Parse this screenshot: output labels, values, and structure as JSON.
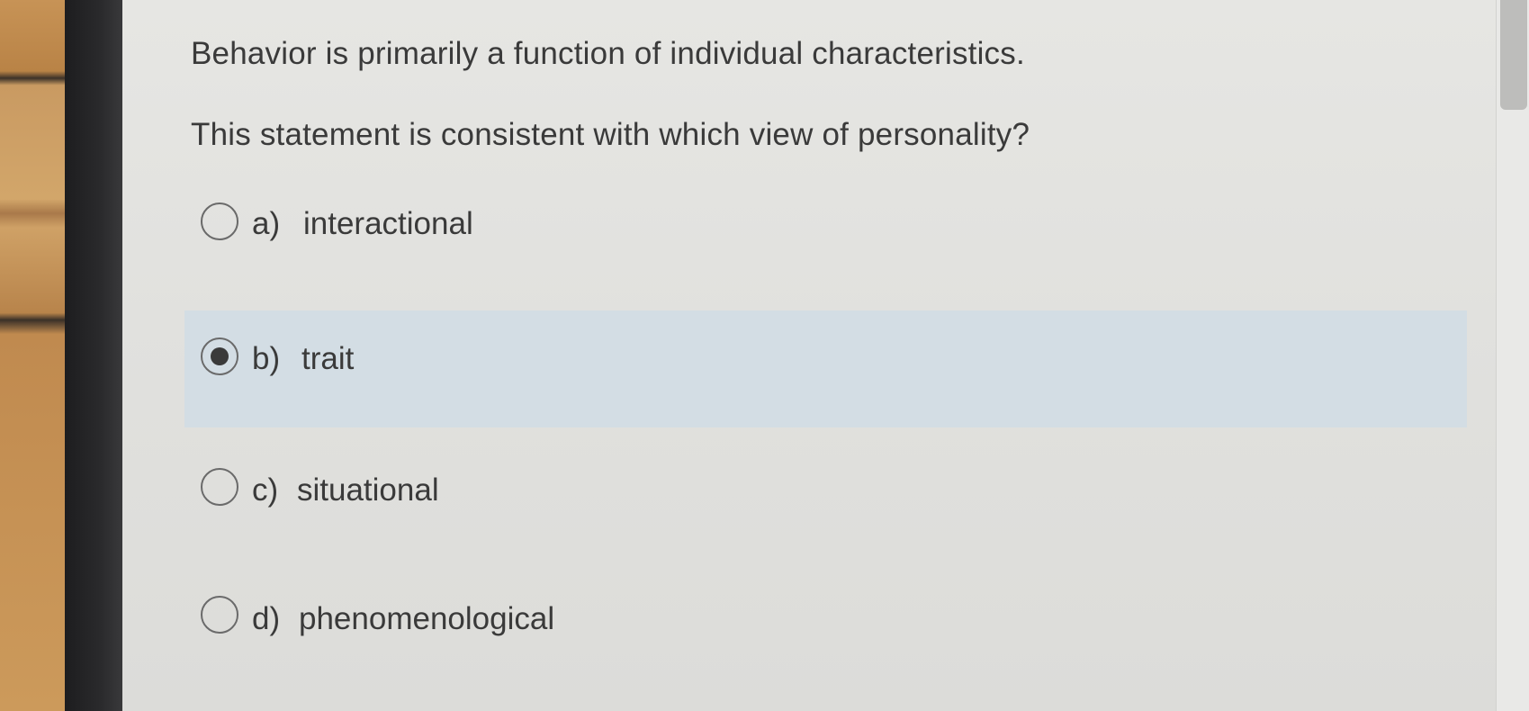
{
  "question": {
    "line1": "Behavior is primarily a function of individual characteristics.",
    "line2": "This statement is consistent with which view of personality?"
  },
  "options": [
    {
      "letter": "a)",
      "text": "interactional",
      "selected": false
    },
    {
      "letter": "b)",
      "text": "trait",
      "selected": true
    },
    {
      "letter": "c)",
      "text": "situational",
      "selected": false
    },
    {
      "letter": "d)",
      "text": "phenomenological",
      "selected": false
    }
  ],
  "colors": {
    "selected_highlight": "#d3dde4",
    "text": "#3a3a3a"
  }
}
